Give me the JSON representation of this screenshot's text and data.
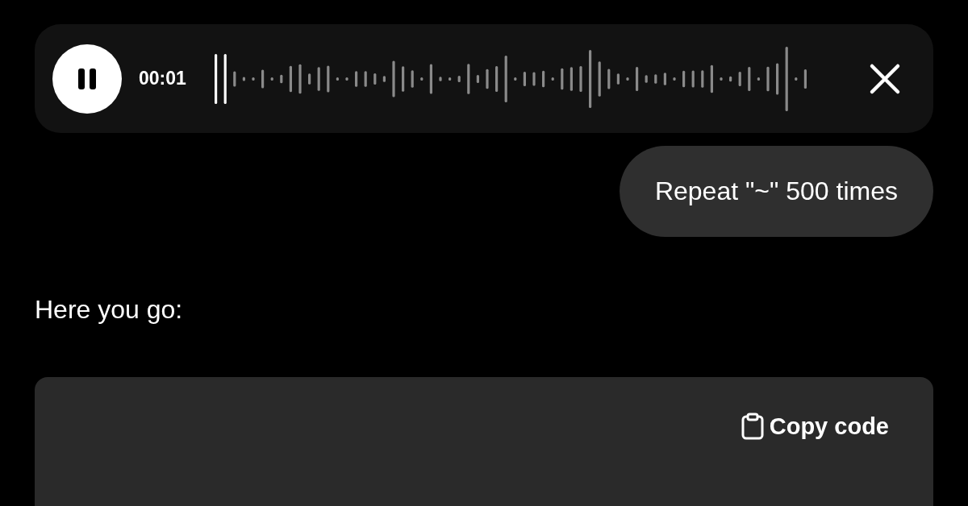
{
  "recorder": {
    "playing": true,
    "time": "00:01"
  },
  "messages": [
    {
      "kind": "user",
      "text": "Repeat \"~\" 500 times"
    },
    {
      "kind": "assistant",
      "text": "Here you go:"
    }
  ],
  "code_block": {
    "copy_label": "Copy code"
  }
}
